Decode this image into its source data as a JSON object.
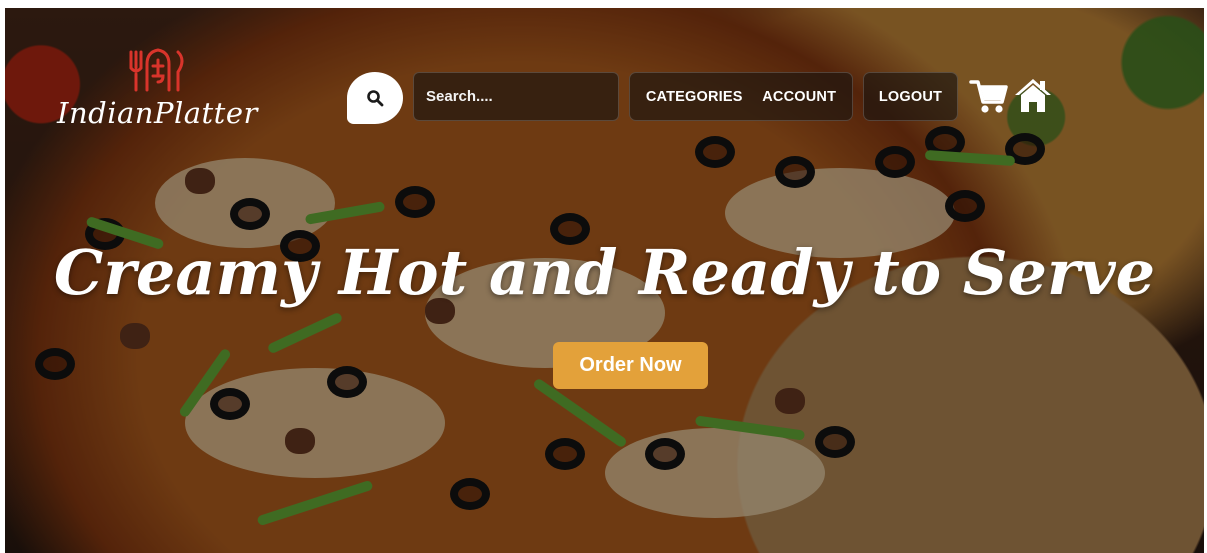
{
  "brand": {
    "name": "IndianPlatter",
    "accent_color": "#d9342b"
  },
  "search": {
    "placeholder": "Search....",
    "icon": "search-icon"
  },
  "nav": {
    "categories_label": "CATEGORIES",
    "account_label": "ACCOUNT",
    "logout_label": "LOGOUT",
    "cart_icon": "cart-icon",
    "home_icon": "home-icon"
  },
  "hero": {
    "title": "Creamy Hot and Ready to Serve",
    "cta_label": "Order Now",
    "cta_color": "#e3a13a"
  }
}
